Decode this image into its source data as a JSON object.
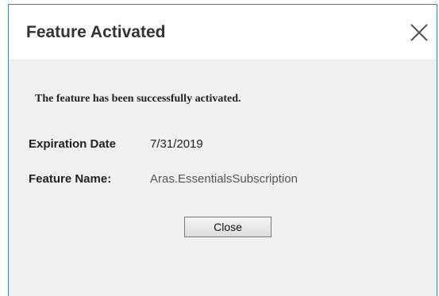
{
  "dialog": {
    "title": "Feature Activated",
    "close_icon": "close-icon",
    "message": "The feature has been successfully activated.",
    "expiration": {
      "label": "Expiration Date",
      "value": "7/31/2019"
    },
    "feature_name": {
      "label": "Feature Name:",
      "value": "Aras.EssentialsSubscription"
    },
    "close_button_label": "Close"
  },
  "colors": {
    "border": "#3c7fc8",
    "dialog_background": "#f0f0f0",
    "title_background": "#ffffff"
  }
}
